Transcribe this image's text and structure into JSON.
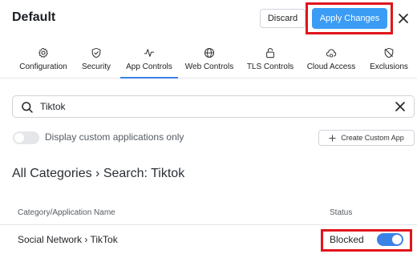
{
  "header": {
    "title": "Default",
    "discard_label": "Discard",
    "apply_label": "Apply Changes"
  },
  "tabs": [
    {
      "label": "Configuration",
      "icon": "gear-icon"
    },
    {
      "label": "Security",
      "icon": "shield-check-icon"
    },
    {
      "label": "App Controls",
      "icon": "pulse-icon",
      "active": true
    },
    {
      "label": "Web Controls",
      "icon": "globe-icon"
    },
    {
      "label": "TLS Controls",
      "icon": "lock-icon"
    },
    {
      "label": "Cloud Access",
      "icon": "cloud-lock-icon"
    },
    {
      "label": "Exclusions",
      "icon": "shield-off-icon"
    }
  ],
  "search": {
    "value": "Tiktok"
  },
  "filter": {
    "toggle_label": "Display custom applications only",
    "toggle_on": false,
    "create_button_label": "Create Custom App"
  },
  "breadcrumb": "All Categories › Search: Tiktok",
  "table": {
    "columns": [
      "Category/Application Name",
      "Status"
    ],
    "rows": [
      {
        "name": "Social Network › TikTok",
        "status": "Blocked",
        "enabled": true
      }
    ]
  },
  "colors": {
    "accent": "#3b82e6",
    "apply_button": "#3b9cf5",
    "highlight": "#e0151c"
  }
}
